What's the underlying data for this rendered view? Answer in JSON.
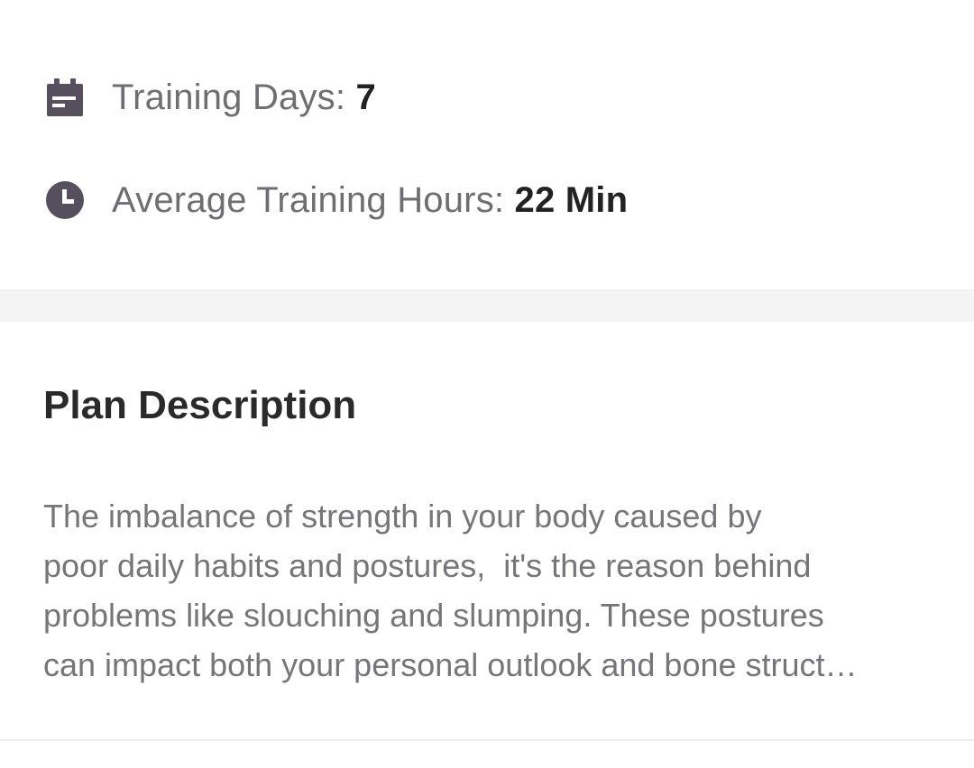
{
  "stats": {
    "training_days": {
      "label": "Training Days: ",
      "value": "7",
      "icon": "calendar-icon"
    },
    "average_training_hours": {
      "label": "Average Training Hours: ",
      "value": "22 Min",
      "icon": "clock-icon"
    }
  },
  "plan_description": {
    "title": "Plan Description",
    "lines": [
      "The imbalance of strength in your body caused by",
      "poor daily habits and postures,  it's the reason behind",
      "problems like slouching and slumping. These postures",
      "can impact both your personal outlook and bone struct…"
    ]
  },
  "colors": {
    "icon": "#56505e",
    "label_text": "#6f6f73",
    "value_text": "#222222",
    "body_text": "#76767a",
    "section_band": "#f4f4f4"
  }
}
